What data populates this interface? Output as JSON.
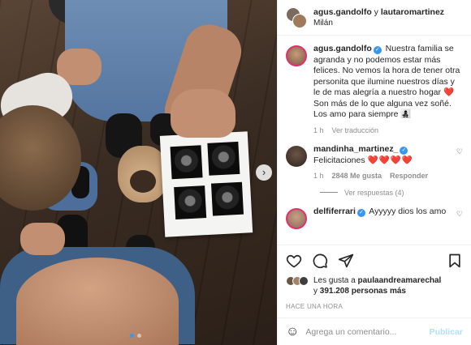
{
  "post": {
    "header": {
      "user1": "agus.gandolfo",
      "connector": "y",
      "user2": "lautaromartinez",
      "location": "Milán"
    },
    "caption": {
      "username": "agus.gandolfo",
      "text": "Nuestra familia se agranda y no podemos estar más felices. No vemos la hora de tener otra personita que ilumine nuestros días y le de mas alegría a nuestro hogar",
      "heart": "❤️",
      "line2": "Son más de lo que alguna vez soñé. Los amo para siempre",
      "line2_emojis": "👩‍👧‍👦",
      "time": "1 h",
      "see_translation": "Ver traducción"
    },
    "comments": [
      {
        "username": "mandinha_martinez_",
        "text": "Felicitaciones",
        "hearts": "❤️❤️❤️❤️",
        "time": "1 h",
        "likes": "2848 Me gusta",
        "reply": "Responder",
        "view_replies": "Ver respuestas (4)"
      },
      {
        "username": "delfiferrari",
        "text": "Ayyyyy dios los amo"
      }
    ],
    "likes": {
      "prefix": "Les gusta a",
      "user": "paulaandreamarechal",
      "connector": "y",
      "count": "391.208 personas más"
    },
    "timestamp": "HACE UNA HORA",
    "add_comment": {
      "placeholder": "Agrega un comentario...",
      "publish": "Publicar"
    },
    "icons": {
      "like": "heart-icon",
      "comment": "comment-icon",
      "share": "share-icon",
      "save": "bookmark-icon",
      "emoji": "smiley-icon",
      "next": "chevron-right-icon"
    },
    "colors": {
      "accent": "#3897f0",
      "heart": "#ed4956",
      "muted": "#8e8e8e"
    }
  }
}
